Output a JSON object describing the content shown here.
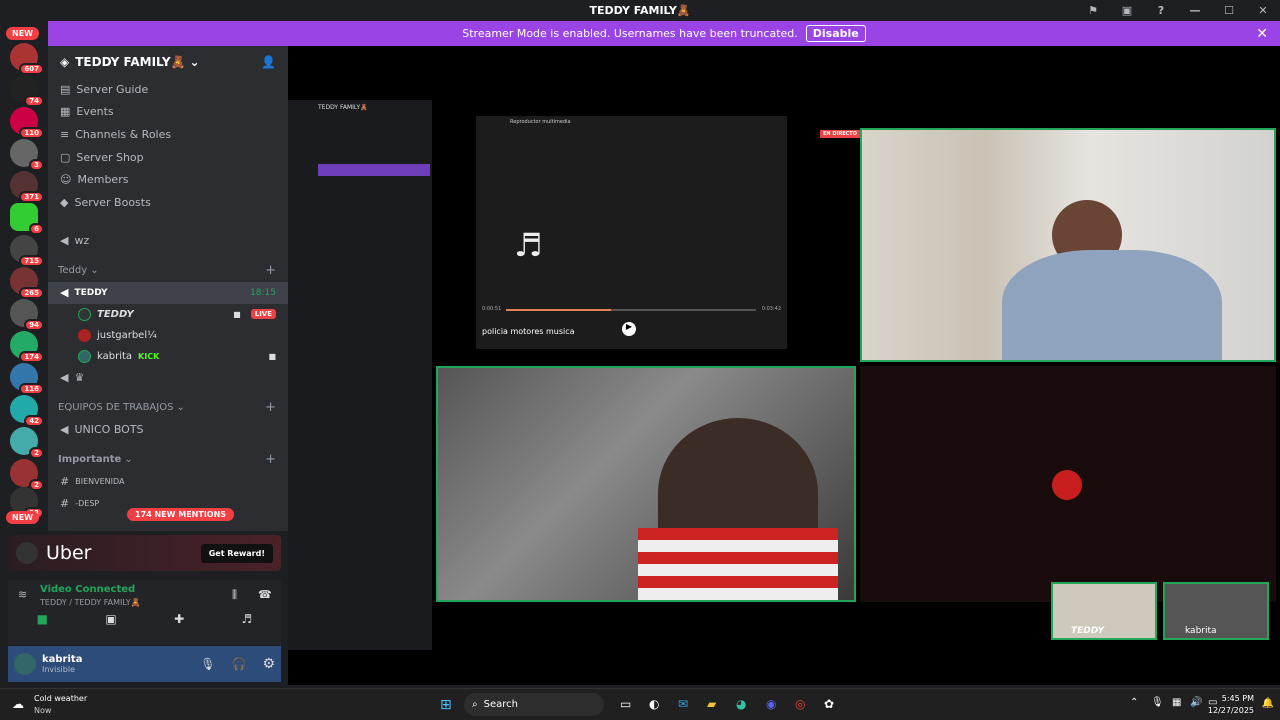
{
  "window": {
    "title": "TEDDY FAMILY🧸"
  },
  "banner": {
    "text": "Streamer Mode is enabled. Usernames have been truncated.",
    "button": "Disable"
  },
  "server_rail": {
    "badges": [
      "607",
      "74",
      "110",
      "3",
      "371",
      "6",
      "715",
      "265",
      "94",
      "174",
      "116",
      "42",
      "2",
      "2",
      "33"
    ],
    "new_top": "NEW",
    "new_bottom": "NEW"
  },
  "server": {
    "name": "TEDDY FAMILY🧸"
  },
  "nav": [
    "Server Guide",
    "Events",
    "Channels & Roles",
    "Server Shop",
    "Members",
    "Server Boosts"
  ],
  "channels": {
    "wz": "wz",
    "teddy_cat": "Teddy",
    "voice_channel": "TEDDY",
    "voice_time": "18:15",
    "users": [
      {
        "name": "TEDDY",
        "badge": "LIVE"
      },
      {
        "name": "justgarbel¼",
        "badge": ""
      },
      {
        "name": "kabrita",
        "badge": "KICK"
      }
    ],
    "equipos_cat": "EQUIPOS DE TRABAJOS",
    "unico": "UNICO BOTS",
    "importante_cat": "Importante",
    "bienvenida": "BIENVENIDA",
    "desp": "-DESP",
    "mentions": "174 NEW MENTIONS"
  },
  "ad": {
    "brand": "Uber",
    "cta": "Get Reward!"
  },
  "voice": {
    "status": "Video Connected",
    "sub": "TEDDY / TEDDY FAMILY🧸"
  },
  "profile": {
    "name": "kabrita",
    "status": "Invisible"
  },
  "media_player": {
    "title": "Reproductor multimedia",
    "track": "policia motores musica",
    "time_now": "0:00:51",
    "time_end": "0:03:42",
    "progress": 0.42
  },
  "stage": {
    "live_tag": "EN DIRECTO",
    "thumb1": "TEDDY",
    "thumb2": "kabrita"
  },
  "taskbar": {
    "weather_title": "Cold weather",
    "weather_sub": "Now",
    "search": "Search",
    "time": "5:45 PM",
    "date": "12/27/2025"
  },
  "colors": {
    "accent": "#9b44e6",
    "live": "#ed4245",
    "connected": "#23a55a"
  }
}
